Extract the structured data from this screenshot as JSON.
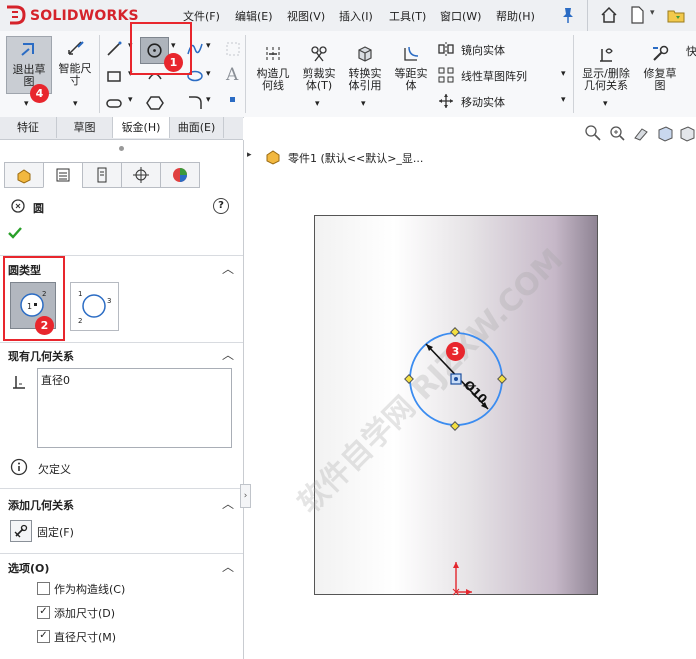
{
  "app": {
    "logo_text": "SOLIDWORKS"
  },
  "menu": [
    "文件(F)",
    "编辑(E)",
    "视图(V)",
    "插入(I)",
    "工具(T)",
    "窗口(W)",
    "帮助(H)"
  ],
  "ribbon": {
    "exit_sketch": "退出草\n图",
    "smart_dim": "智能尺\n寸",
    "construct_geom": "构造几\n何线",
    "trim": "剪裁实\n体(T)",
    "convert": "转换实\n体引用",
    "offset": "等距实\n体",
    "mirror": "镜向实体",
    "linear_pattern": "线性草图阵列",
    "move": "移动实体",
    "show_delete_relations": "显示/删除\n几何关系",
    "repair": "修复草\n图"
  },
  "tabs": [
    "特征",
    "草图",
    "钣金(H)",
    "曲面(E)"
  ],
  "pm": {
    "title": "圆",
    "help": "?",
    "circle_type_label": "圆类型",
    "existing_relations_label": "现有几何关系",
    "relation_item": "直径0",
    "status": "欠定义",
    "add_relations_label": "添加几何关系",
    "fix_label": "固定(F)",
    "options_label": "选项(O)",
    "options": [
      {
        "label": "作为构造线(C)",
        "checked": false
      },
      {
        "label": "添加尺寸(D)",
        "checked": true
      },
      {
        "label": "直径尺寸(M)",
        "checked": true
      }
    ]
  },
  "tree": {
    "part_label": "零件1 (默认<<默认>_显..."
  },
  "dimension": {
    "text": "Ø10"
  },
  "watermark": "软件自学网 RJZXW.COM",
  "badges": [
    "1",
    "2",
    "3",
    "4"
  ],
  "colors": {
    "accent_red": "#e8262d",
    "sketch_blue": "#3b8cf0"
  }
}
